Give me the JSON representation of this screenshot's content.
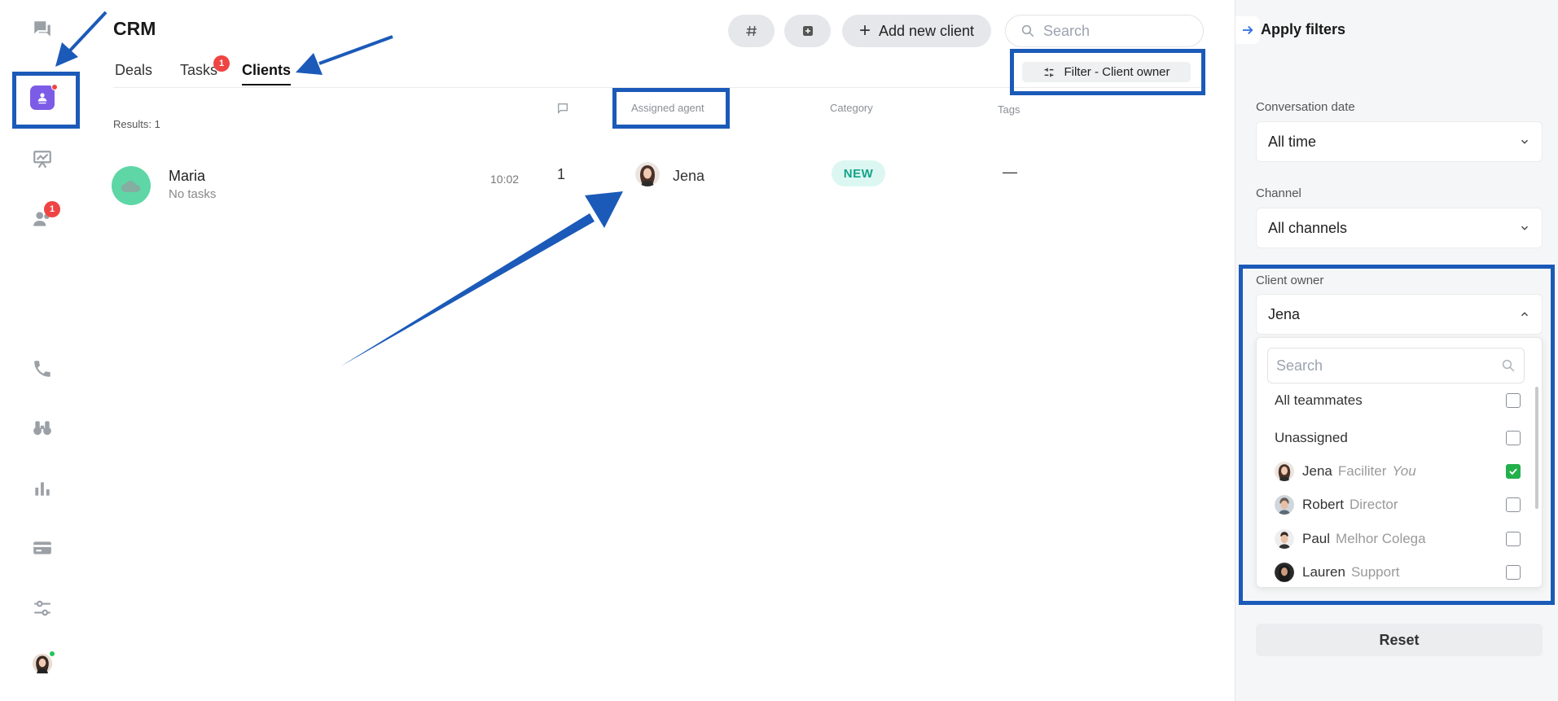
{
  "app": {
    "title": "CRM"
  },
  "rail": {
    "badges": {
      "team": "1"
    }
  },
  "tabs": [
    {
      "label": "Deals"
    },
    {
      "label": "Tasks",
      "badge": "1"
    },
    {
      "label": "Clients"
    }
  ],
  "toolbar": {
    "add_client_label": "Add new client",
    "search_placeholder": "Search",
    "filter_label": "Filter - Client owner"
  },
  "table": {
    "results": "Results: 1",
    "columns": {
      "agent": "Assigned agent",
      "category": "Category",
      "tags": "Tags"
    },
    "rows": [
      {
        "name": "Maria",
        "sub": "No tasks",
        "time": "10:02",
        "messages": "1",
        "agent": "Jena",
        "category": "NEW",
        "tags": "—"
      }
    ]
  },
  "panel": {
    "title": "Apply filters",
    "conversation_date": {
      "label": "Conversation date",
      "value": "All time"
    },
    "channel": {
      "label": "Channel",
      "value": "All channels"
    },
    "client_owner": {
      "label": "Client owner",
      "value": "Jena",
      "search_placeholder": "Search",
      "options": [
        {
          "name": "All teammates",
          "role": "",
          "you": "",
          "checked": false
        },
        {
          "name": "Unassigned",
          "role": "",
          "you": "",
          "checked": false
        },
        {
          "name": "Jena",
          "role": "Faciliter",
          "you": "You",
          "checked": true
        },
        {
          "name": "Robert",
          "role": "Director",
          "you": "",
          "checked": false
        },
        {
          "name": "Paul",
          "role": "Melhor Colega",
          "you": "",
          "checked": false
        },
        {
          "name": "Lauren",
          "role": "Support",
          "you": "",
          "checked": false
        }
      ]
    },
    "reset_label": "Reset"
  },
  "colors": {
    "annotation": "#1b5ab8",
    "accent_purple": "#7c5ce6",
    "badge_red": "#ef4444",
    "check_green": "#22b04b",
    "category_teal": "#14a38b"
  }
}
